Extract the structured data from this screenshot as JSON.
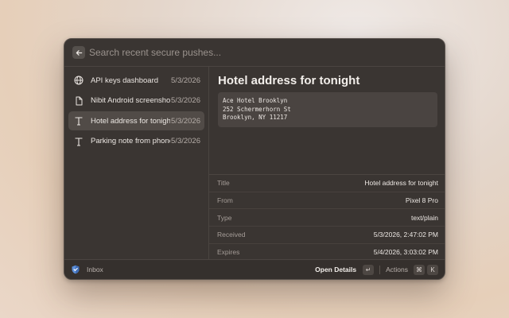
{
  "search": {
    "placeholder": "Search recent secure pushes..."
  },
  "list": {
    "items": [
      {
        "icon": "globe-icon",
        "label": "API keys dashboard",
        "date": "5/3/2026",
        "selected": false
      },
      {
        "icon": "file-icon",
        "label": "Nibit Android screenshot",
        "date": "5/3/2026",
        "selected": false
      },
      {
        "icon": "text-icon",
        "label": "Hotel address for tonight",
        "date": "5/3/2026",
        "selected": true
      },
      {
        "icon": "text-icon",
        "label": "Parking note from phone",
        "date": "5/3/2026",
        "selected": false
      }
    ]
  },
  "detail": {
    "title": "Hotel address for tonight",
    "content_lines": [
      "Ace Hotel Brooklyn",
      "252 Schermerhorn St",
      "Brooklyn, NY 11217"
    ],
    "metadata": [
      {
        "label": "Title",
        "value": "Hotel address for tonight"
      },
      {
        "label": "From",
        "value": "Pixel 8 Pro"
      },
      {
        "label": "Type",
        "value": "text/plain"
      },
      {
        "label": "Received",
        "value": "5/3/2026, 2:47:02 PM"
      },
      {
        "label": "Expires",
        "value": "5/4/2026, 3:03:02 PM"
      }
    ]
  },
  "footer": {
    "inbox_label": "Inbox",
    "open_details_label": "Open Details",
    "open_details_key": "↵",
    "actions_label": "Actions",
    "actions_keys": [
      "⌘",
      "K"
    ]
  },
  "colors": {
    "window_bg": "#3a3532",
    "selected_bg": "#514b47",
    "accent_shield": "#5b8ed8"
  }
}
